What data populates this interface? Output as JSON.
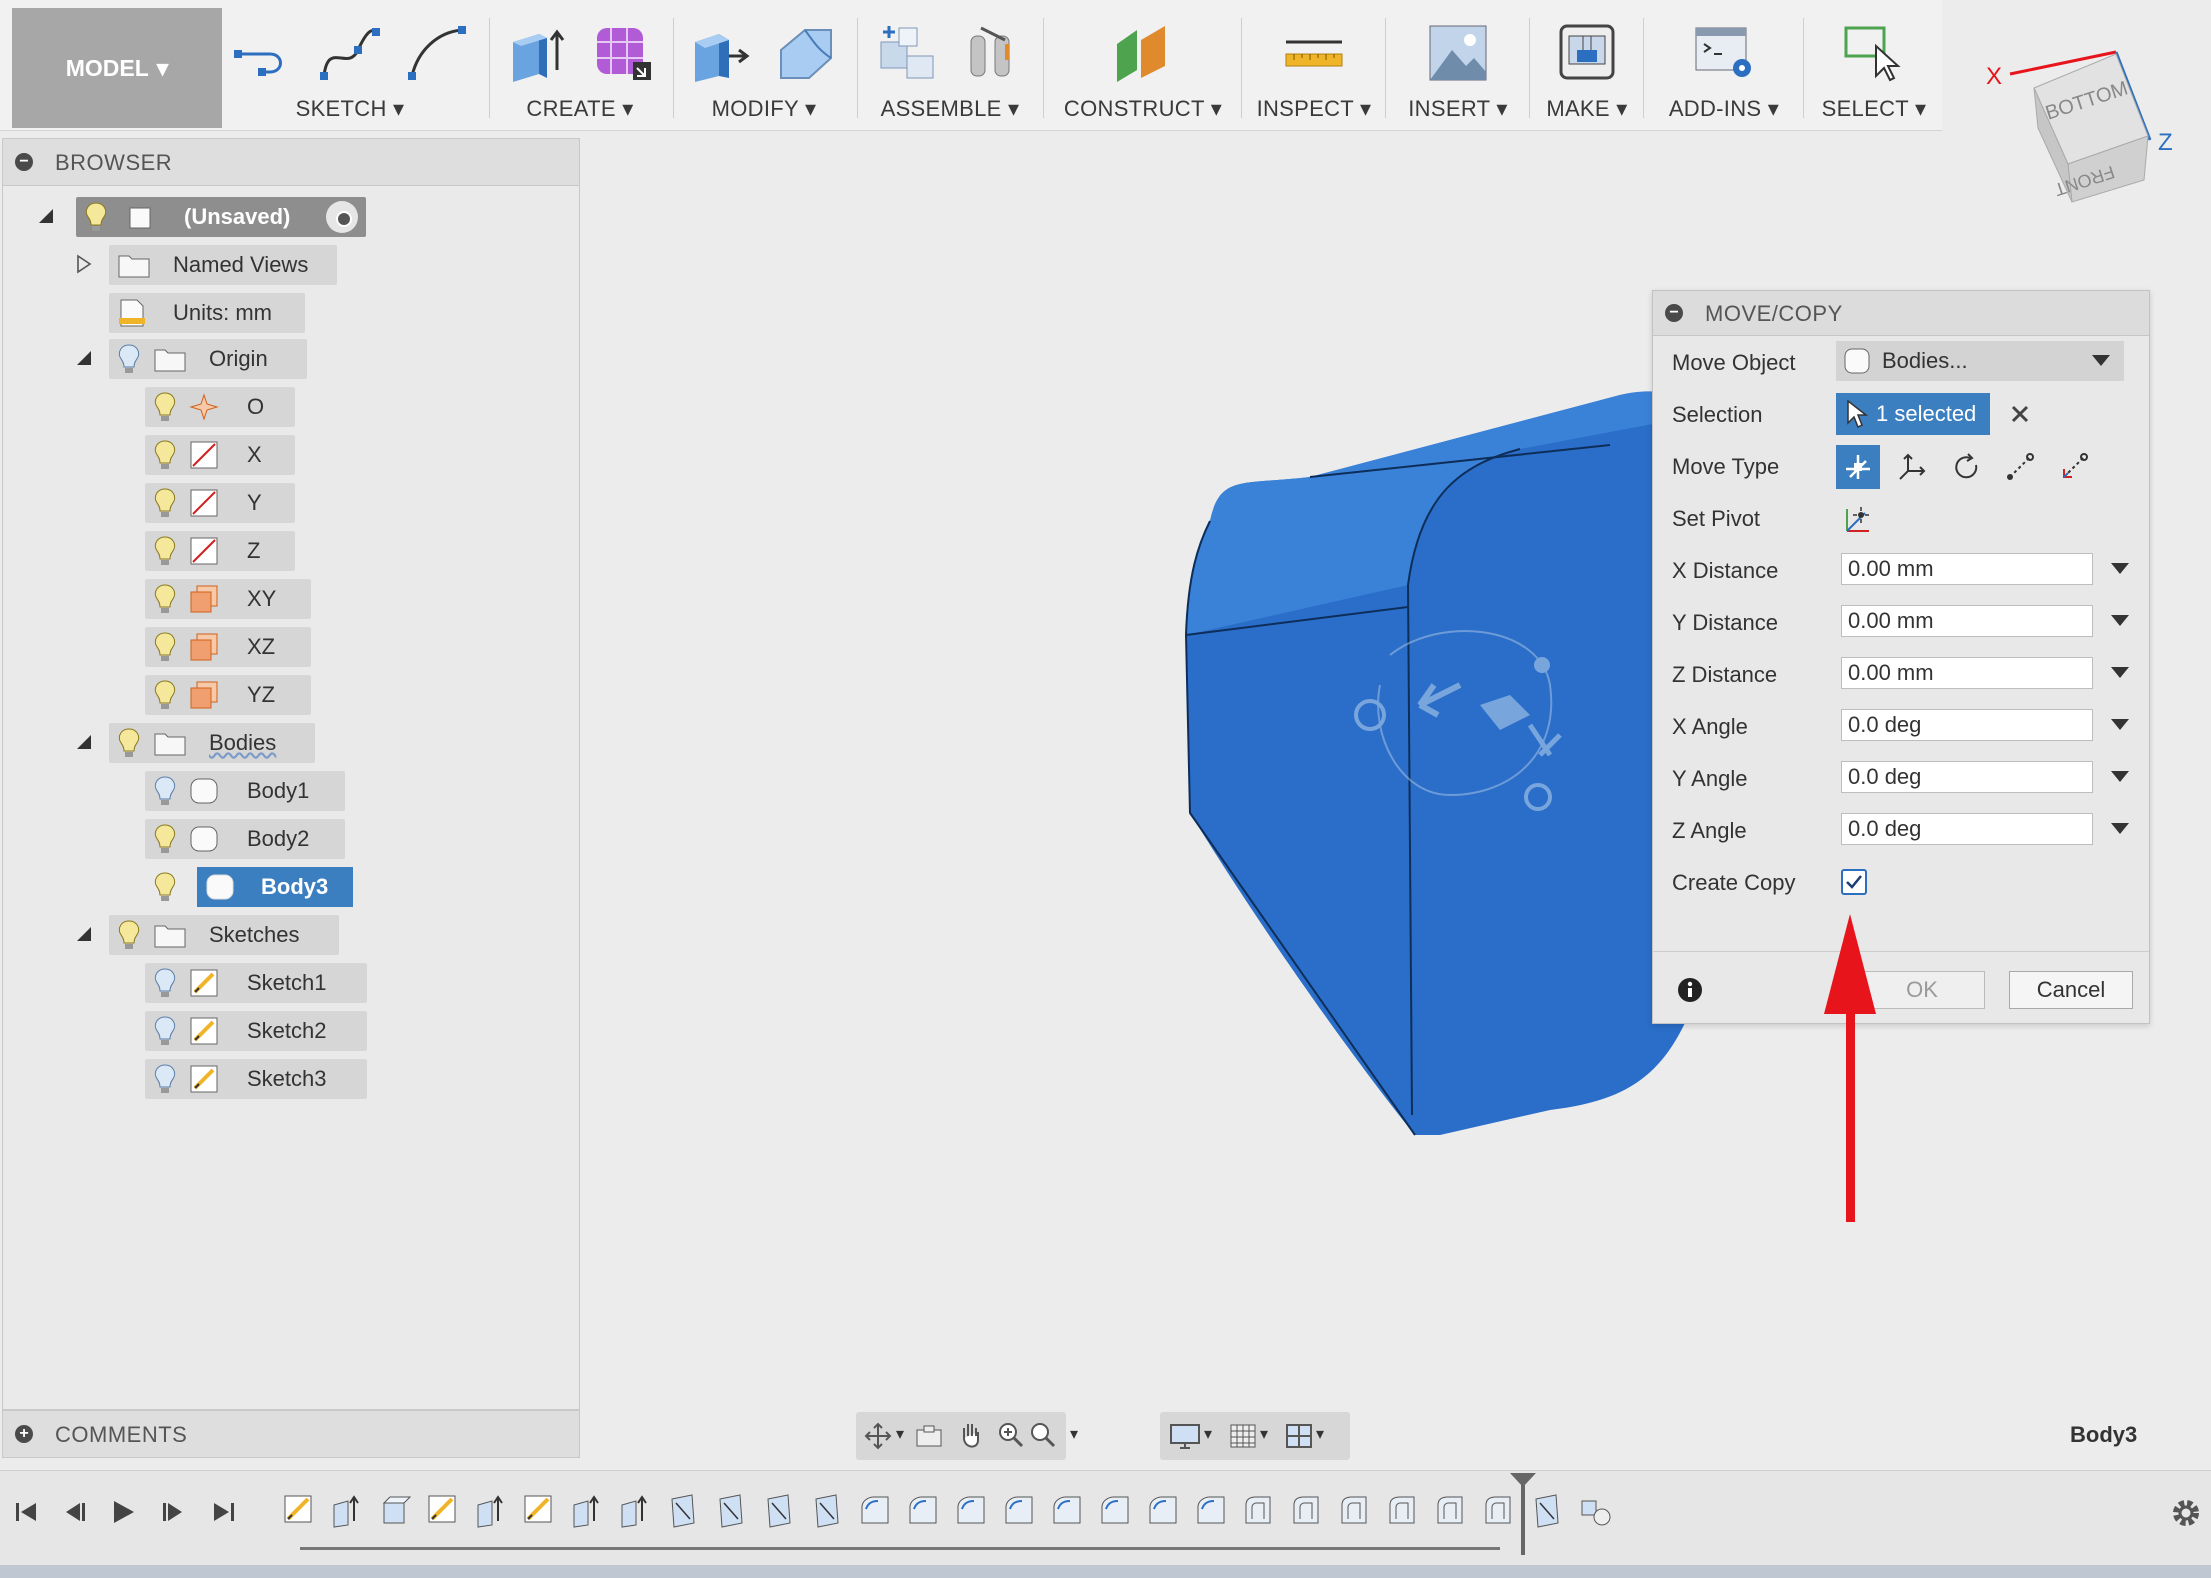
{
  "toolbar": {
    "workspace": "MODEL",
    "groups": [
      {
        "label": "SKETCH"
      },
      {
        "label": "CREATE"
      },
      {
        "label": "MODIFY"
      },
      {
        "label": "ASSEMBLE"
      },
      {
        "label": "CONSTRUCT"
      },
      {
        "label": "INSPECT"
      },
      {
        "label": "INSERT"
      },
      {
        "label": "MAKE"
      },
      {
        "label": "ADD-INS"
      },
      {
        "label": "SELECT"
      }
    ]
  },
  "viewcube": {
    "face_top": "BOTTOM",
    "face_front": "FRONT",
    "axis_x": "X",
    "axis_z": "Z"
  },
  "browser": {
    "title": "BROWSER",
    "root": "(Unsaved)",
    "named_views": "Named Views",
    "units": "Units: mm",
    "origin": "Origin",
    "origin_items": [
      "O",
      "X",
      "Y",
      "Z",
      "XY",
      "XZ",
      "YZ"
    ],
    "bodies": "Bodies",
    "body_items": [
      "Body1",
      "Body2",
      "Body3"
    ],
    "sketches": "Sketches",
    "sketch_items": [
      "Sketch1",
      "Sketch2",
      "Sketch3"
    ]
  },
  "comments": {
    "title": "COMMENTS"
  },
  "dialog": {
    "title": "MOVE/COPY",
    "move_object_label": "Move Object",
    "move_object_value": "Bodies...",
    "selection_label": "Selection",
    "selection_value": "1 selected",
    "move_type_label": "Move Type",
    "set_pivot_label": "Set Pivot",
    "fields": [
      {
        "label": "X Distance",
        "value": "0.00 mm"
      },
      {
        "label": "Y Distance",
        "value": "0.00 mm"
      },
      {
        "label": "Z Distance",
        "value": "0.00 mm"
      },
      {
        "label": "X Angle",
        "value": "0.0 deg"
      },
      {
        "label": "Y Angle",
        "value": "0.0 deg"
      },
      {
        "label": "Z Angle",
        "value": "0.0 deg"
      }
    ],
    "create_copy_label": "Create Copy",
    "create_copy_checked": true,
    "ok_label": "OK",
    "cancel_label": "Cancel"
  },
  "status": {
    "selected_body": "Body3"
  },
  "colors": {
    "accent": "#3c7fc0",
    "body": "#2a6ec9",
    "arrow": "#e8141b"
  }
}
